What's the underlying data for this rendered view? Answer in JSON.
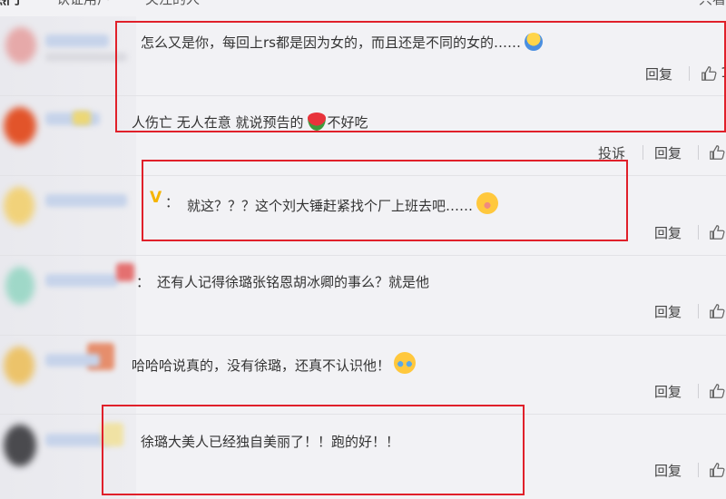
{
  "tabs": {
    "hot": "热门",
    "verified": "认证用户",
    "following": "关注的人",
    "right": "只看"
  },
  "comments": [
    {
      "prefix": "",
      "text": "怎么又是你，每回上rs都是因为女的，而且还是不同的女的……",
      "emoji": "person-emoji",
      "reply": "回复",
      "like_count": "1"
    },
    {
      "prefix": "",
      "text": "人伤亡 无人在意 就说预告的",
      "emoji": "watermelon-emoji",
      "text_after": "不好吃",
      "report": "投诉",
      "reply": "回复"
    },
    {
      "prefix": "：",
      "text": "就这？？？这个刘大锤赶紧找个厂上班去吧……",
      "emoji": "crying-face-emoji",
      "reply": "回复"
    },
    {
      "prefix": "：",
      "text": "还有人记得徐璐张铭恩胡冰卿的事么？就是他",
      "reply": "回复"
    },
    {
      "prefix": "",
      "text": "哈哈哈说真的，没有徐璐，还真不认识他！",
      "emoji": "laughing-crying-emoji",
      "reply": "回复"
    },
    {
      "prefix": "",
      "text": "徐璐大美人已经独自美丽了！！跑的好！！",
      "reply": "回复"
    }
  ],
  "colors": {
    "highlight": "#e0202a",
    "verified": "#f5b400"
  }
}
